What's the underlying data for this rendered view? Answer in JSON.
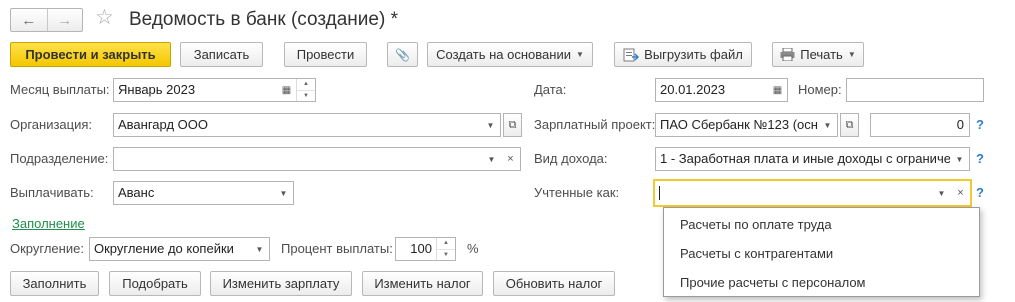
{
  "window": {
    "title": "Ведомость в банк (создание) *",
    "back_icon": "←",
    "forward_icon": "→",
    "favorite_icon": "☆"
  },
  "toolbar": {
    "post_and_close": "Провести и закрыть",
    "save": "Записать",
    "post": "Провести",
    "attach_icon": "📎",
    "create_based_on": "Создать на основании",
    "upload_file": "Выгрузить файл",
    "print": "Печать"
  },
  "form": {
    "payment_month": {
      "label": "Месяц выплаты:",
      "value": "Январь 2023"
    },
    "date": {
      "label": "Дата:",
      "value": "20.01.2023"
    },
    "number": {
      "label": "Номер:",
      "value": ""
    },
    "organization": {
      "label": "Организация:",
      "value": "Авангард ООО"
    },
    "salary_project": {
      "label": "Зарплатный проект:",
      "value": "ПАО Сбербанк №123 (осн",
      "amount": "0"
    },
    "department": {
      "label": "Подразделение:",
      "value": ""
    },
    "income_type": {
      "label": "Вид дохода:",
      "value": "1 - Заработная плата и иные доходы с ограниче"
    },
    "pay_out": {
      "label": "Выплачивать:",
      "value": "Аванс"
    },
    "accounted_as": {
      "label": "Учтенные как:",
      "value": ""
    },
    "filling_link": "Заполнение",
    "rounding": {
      "label": "Округление:",
      "value": "Округление до копейки"
    },
    "payout_percent": {
      "label": "Процент выплаты:",
      "value": "100",
      "unit": "%"
    },
    "help_mark": "?"
  },
  "bottom_buttons": {
    "fill": "Заполнить",
    "select": "Подобрать",
    "change_salary": "Изменить зарплату",
    "change_tax": "Изменить налог",
    "update_tax": "Обновить налог"
  },
  "dropdown": {
    "items": [
      "Расчеты по оплате труда",
      "Расчеты с контрагентами",
      "Прочие расчеты с персоналом"
    ]
  },
  "colors": {
    "primary_button": "#f3c700",
    "focus_border": "#f2c92e",
    "link": "#1e8f4c",
    "help": "#2f7fc8"
  }
}
